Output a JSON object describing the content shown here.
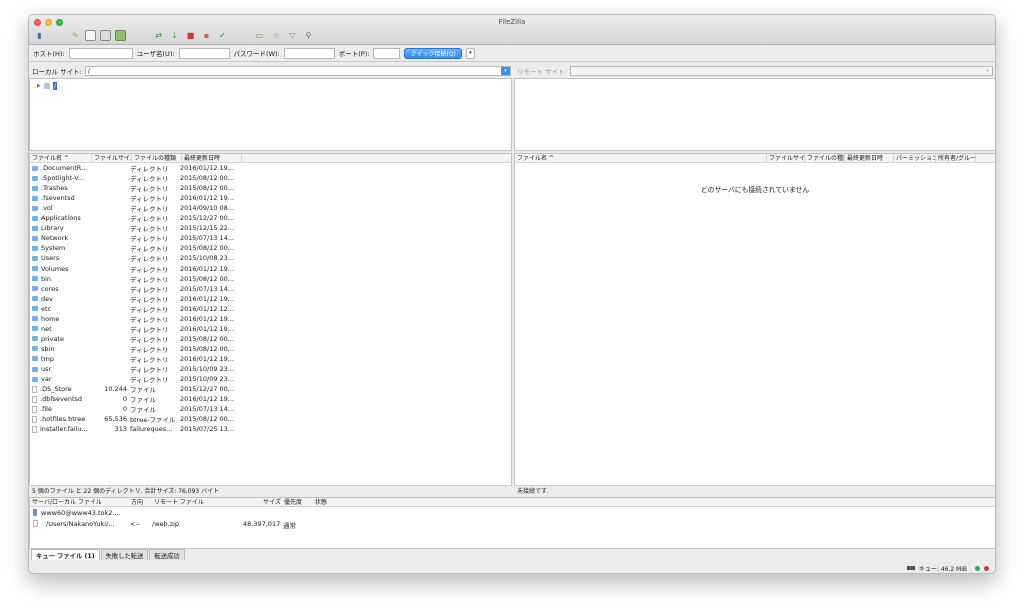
{
  "window": {
    "title": "FileZilla"
  },
  "toolbar": {
    "icons": [
      "site-manager-icon",
      "log-icon",
      "tree-icon",
      "remote-tree-icon",
      "queue-icon",
      "refresh-icon",
      "process-queue-icon",
      "cancel-icon",
      "disconnect-icon",
      "reconnect-icon",
      "filter-icon",
      "compare-icon",
      "sync-browse-icon",
      "search-icon"
    ]
  },
  "quickconnect": {
    "host_label": "ホスト(H):",
    "user_label": "ユーザ名(U):",
    "password_label": "パスワード(W):",
    "port_label": "ポート(P):",
    "host_value": "",
    "user_value": "",
    "password_value": "",
    "port_value": "",
    "connect_label": "クイック接続(Q)",
    "dropdown_glyph": "▾"
  },
  "local": {
    "site_label": "ローカル サイト:",
    "site_path": "/",
    "tree_root": "/",
    "columns": [
      "ファイル名 ^",
      "ファイルサイズ",
      "ファイルの種類",
      "最終更新日時"
    ],
    "rows": [
      {
        "name": ".DocumentR...",
        "size": "",
        "type": "ディレクトリ",
        "date": "2016/01/12 19...",
        "kind": "folder"
      },
      {
        "name": ".Spotlight-V...",
        "size": "",
        "type": "ディレクトリ",
        "date": "2015/08/12 00...",
        "kind": "folder"
      },
      {
        "name": ".Trashes",
        "size": "",
        "type": "ディレクトリ",
        "date": "2015/08/12 00...",
        "kind": "folder"
      },
      {
        "name": ".fseventsd",
        "size": "",
        "type": "ディレクトリ",
        "date": "2016/01/12 19...",
        "kind": "folder"
      },
      {
        "name": ".vol",
        "size": "",
        "type": "ディレクトリ",
        "date": "2014/09/10 08...",
        "kind": "folder"
      },
      {
        "name": "Applications",
        "size": "",
        "type": "ディレクトリ",
        "date": "2015/12/27 00...",
        "kind": "folder"
      },
      {
        "name": "Library",
        "size": "",
        "type": "ディレクトリ",
        "date": "2015/12/15 22...",
        "kind": "folder"
      },
      {
        "name": "Network",
        "size": "",
        "type": "ディレクトリ",
        "date": "2015/07/13 14...",
        "kind": "folder"
      },
      {
        "name": "System",
        "size": "",
        "type": "ディレクトリ",
        "date": "2015/08/12 00...",
        "kind": "folder"
      },
      {
        "name": "Users",
        "size": "",
        "type": "ディレクトリ",
        "date": "2015/10/08 23...",
        "kind": "folder"
      },
      {
        "name": "Volumes",
        "size": "",
        "type": "ディレクトリ",
        "date": "2016/01/12 19...",
        "kind": "folder"
      },
      {
        "name": "bin",
        "size": "",
        "type": "ディレクトリ",
        "date": "2015/08/12 00...",
        "kind": "folder"
      },
      {
        "name": "cores",
        "size": "",
        "type": "ディレクトリ",
        "date": "2015/07/13 14...",
        "kind": "folder"
      },
      {
        "name": "dev",
        "size": "",
        "type": "ディレクトリ",
        "date": "2016/01/12 19...",
        "kind": "folder"
      },
      {
        "name": "etc",
        "size": "",
        "type": "ディレクトリ",
        "date": "2016/01/12 12...",
        "kind": "folder"
      },
      {
        "name": "home",
        "size": "",
        "type": "ディレクトリ",
        "date": "2016/01/12 19...",
        "kind": "folder"
      },
      {
        "name": "net",
        "size": "",
        "type": "ディレクトリ",
        "date": "2016/01/12 19...",
        "kind": "folder"
      },
      {
        "name": "private",
        "size": "",
        "type": "ディレクトリ",
        "date": "2015/08/12 00...",
        "kind": "folder"
      },
      {
        "name": "sbin",
        "size": "",
        "type": "ディレクトリ",
        "date": "2015/08/12 00...",
        "kind": "folder"
      },
      {
        "name": "tmp",
        "size": "",
        "type": "ディレクトリ",
        "date": "2016/01/12 19...",
        "kind": "folder"
      },
      {
        "name": "usr",
        "size": "",
        "type": "ディレクトリ",
        "date": "2015/10/09 23...",
        "kind": "folder"
      },
      {
        "name": "var",
        "size": "",
        "type": "ディレクトリ",
        "date": "2015/10/09 23...",
        "kind": "folder"
      },
      {
        "name": ".DS_Store",
        "size": "10,244",
        "type": "ファイル",
        "date": "2015/12/27 00...",
        "kind": "file"
      },
      {
        "name": ".dbfseventsd",
        "size": "0",
        "type": "ファイル",
        "date": "2016/01/12 19...",
        "kind": "file"
      },
      {
        "name": ".file",
        "size": "0",
        "type": "ファイル",
        "date": "2015/07/13 14...",
        "kind": "file"
      },
      {
        "name": ".hotfiles.btree",
        "size": "65,536",
        "type": "btree-ファイル",
        "date": "2015/08/12 00...",
        "kind": "file"
      },
      {
        "name": "installer.failu...",
        "size": "313",
        "type": "failureques...",
        "date": "2015/07/25 13...",
        "kind": "file"
      }
    ],
    "status": "5 個のファイル と 22 個のディレクトリ. 合計サイズ: 76,093 バイト"
  },
  "remote": {
    "site_label": "リモート サイト:",
    "site_path": "",
    "columns": [
      "ファイル名 ^",
      "ファイルサイズ",
      "ファイルの種類",
      "最終更新日時",
      "パーミッション",
      "所有者/グループ"
    ],
    "empty_message": "どのサーバにも接続されていません",
    "status": "未接続です."
  },
  "queue": {
    "columns": [
      "サーバ/ローカル ファイル",
      "方向",
      "リモート ファイル",
      "サイズ",
      "優先度",
      "状態"
    ],
    "server": "www60@www43.tok2....",
    "local_file": "/Users/NakanoYuki/...",
    "direction": "<--",
    "remote_file": "/web.zip",
    "size": "48,397,017",
    "priority": "通常"
  },
  "tabs": [
    "キュー ファイル (1)",
    "失敗した転送",
    "転送成功"
  ],
  "statusbar": {
    "queue": "キュー: 46.2 MiB"
  },
  "colors": {
    "accent": "#2f86f1",
    "folder": "#73aef0",
    "led_green": "#2bb24c",
    "led_red": "#d8342c"
  }
}
